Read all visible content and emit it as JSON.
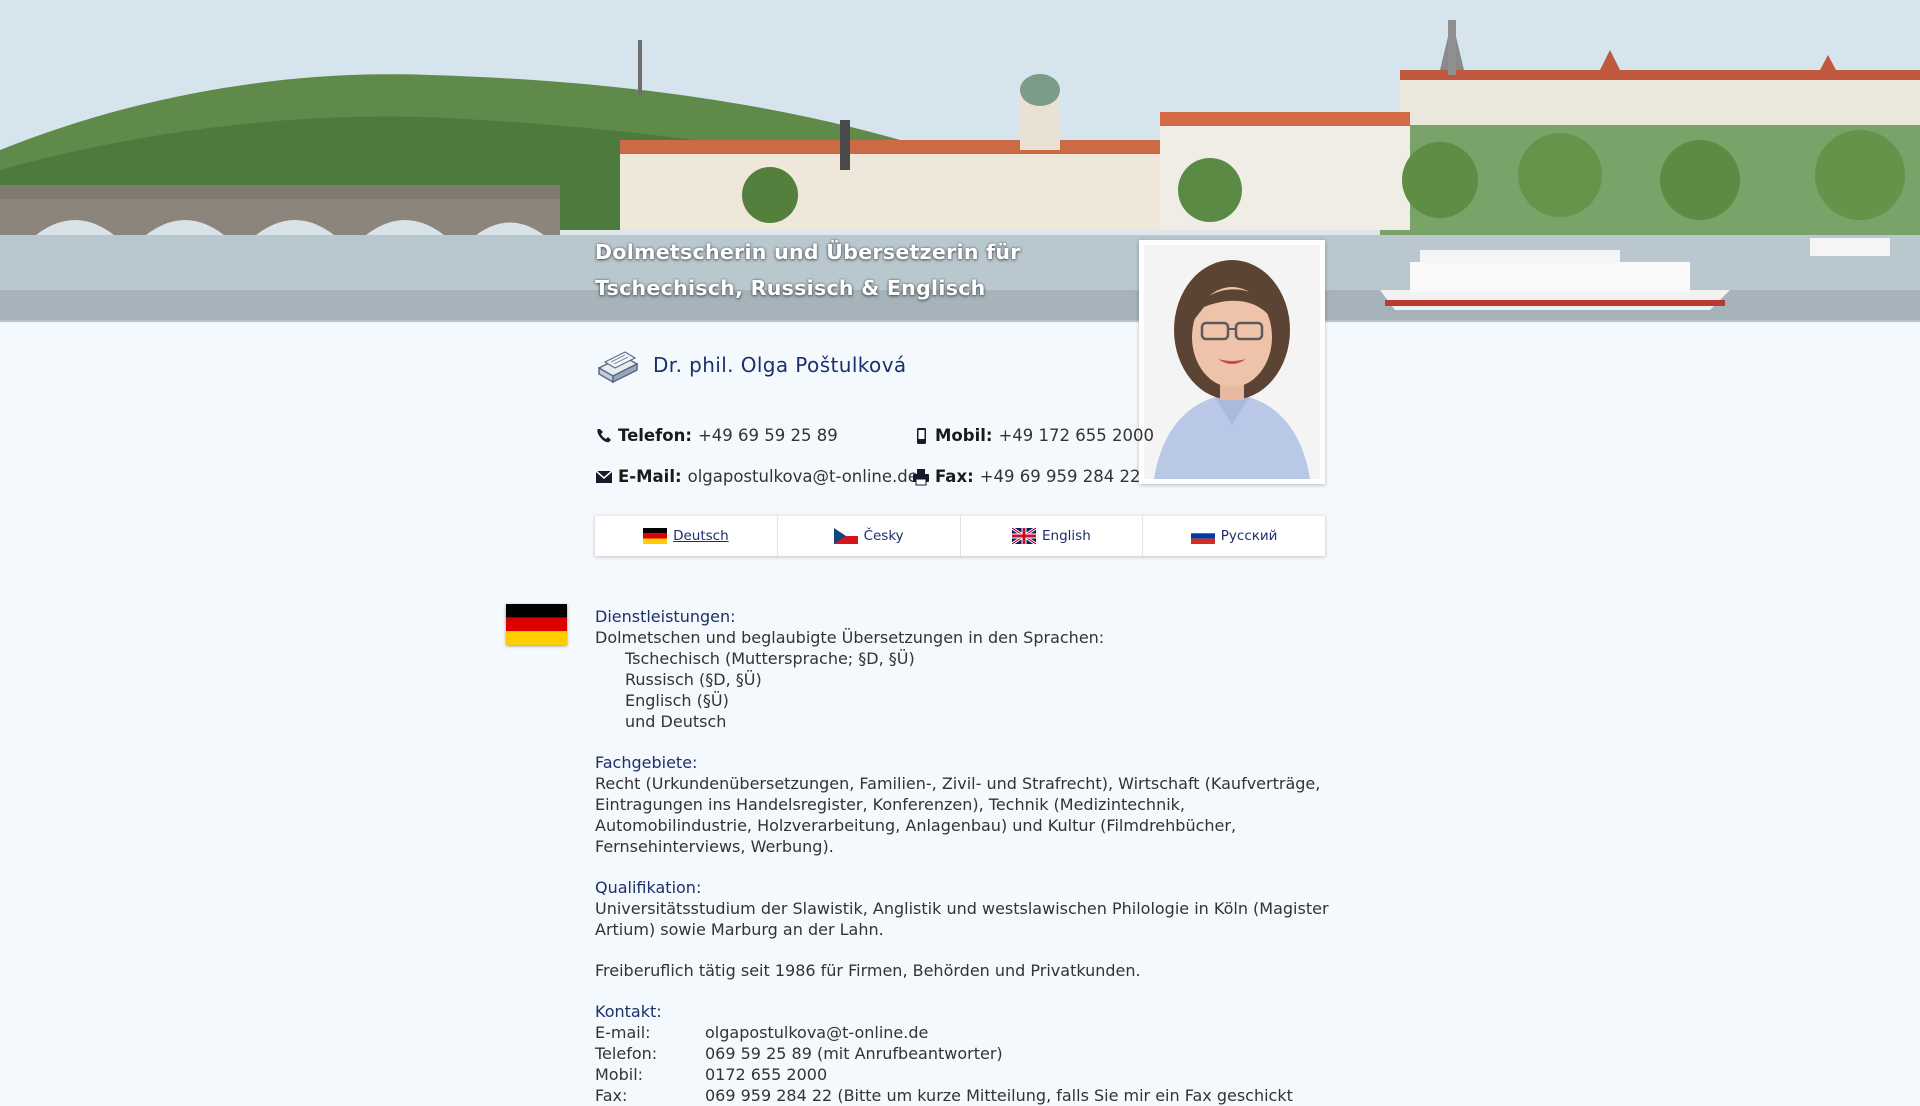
{
  "header": {
    "tagline_line1": "Dolmetscherin und Übersetzerin für",
    "tagline_line2": "Tschechisch, Russisch & Englisch"
  },
  "person": {
    "name": "Dr. phil. Olga Poštulková"
  },
  "contact": {
    "phone_label": "Telefon:",
    "phone_value": "+49 69 59 25 89",
    "mobile_label": "Mobil:",
    "mobile_value": "+49 172 655 2000",
    "email_label": "E-Mail:",
    "email_value": "olgapostulkova@t-online.de",
    "fax_label": "Fax:",
    "fax_value": "+49 69 959 284 22"
  },
  "languages": [
    {
      "label": "Deutsch",
      "icon": "germany-flag-icon",
      "active": true
    },
    {
      "label": "Česky",
      "icon": "czech-flag-icon",
      "active": false
    },
    {
      "label": "English",
      "icon": "uk-flag-icon",
      "active": false
    },
    {
      "label": "Русский",
      "icon": "russia-flag-icon",
      "active": false
    }
  ],
  "main": {
    "services_heading": "Dienstleistungen:",
    "services_intro": "Dolmetschen und beglaubigte Übersetzungen in den Sprachen:",
    "services_items": [
      "Tschechisch (Muttersprache; §D, §Ü)",
      "Russisch (§D, §Ü)",
      "Englisch (§Ü)",
      "und Deutsch"
    ],
    "fields_heading": "Fachgebiete:",
    "fields_text": "Recht (Urkundenübersetzungen, Familien-, Zivil- und Strafrecht), Wirtschaft (Kaufverträge, Eintragungen ins Handelsregister, Konferenzen), Technik (Medizintechnik, Automobilindustrie, Holzverarbeitung, Anlagenbau) und Kultur (Filmdrehbücher, Fernsehinterviews, Werbung).",
    "qual_heading": "Qualifikation:",
    "qual_text": "Universitätsstudium der Slawistik, Anglistik und westslawischen Philologie in Köln (Magister Artium) sowie Marburg an der Lahn.",
    "freelance_text": "Freiberuflich tätig seit 1986 für Firmen, Behörden und Privatkunden.",
    "kontakt_heading": "Kontakt:",
    "kontakt_rows": [
      {
        "k": "E-mail:",
        "v": "olgapostulkova@t-online.de"
      },
      {
        "k": "Telefon:",
        "v": "069 59 25 89 (mit Anrufbeantworter)"
      },
      {
        "k": "Mobil:",
        "v": "0172 655 2000"
      },
      {
        "k": "Fax:",
        "v": "069 959 284 22 (Bitte um kurze Mitteilung, falls Sie mir ein Fax geschickt"
      }
    ]
  },
  "colors": {
    "accent": "#1c2f6b",
    "background": "#f4f9fd"
  }
}
